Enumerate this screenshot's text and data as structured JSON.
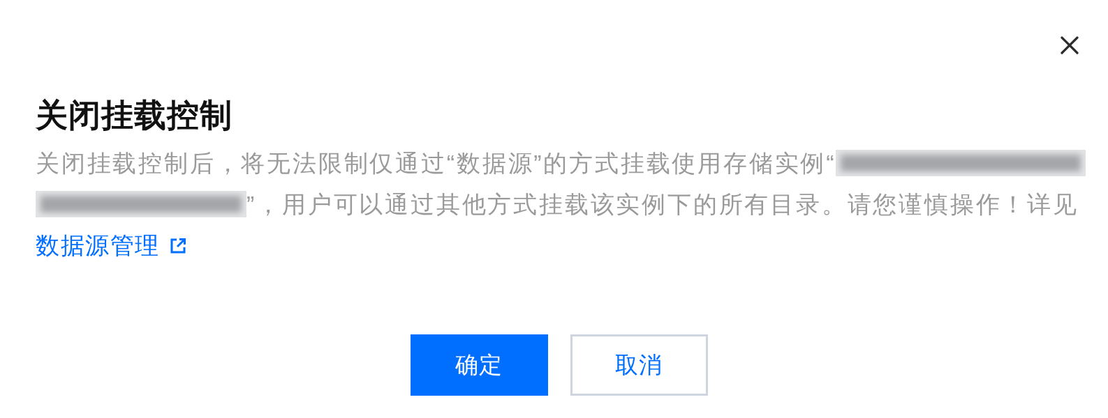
{
  "dialog": {
    "closable": true,
    "title": "关闭挂载控制",
    "description": [
      {
        "kind": "text",
        "text": "关闭挂载控制后，将无法限制仅通过“数据源”的方式挂载使用存储实例“"
      },
      {
        "kind": "redacted"
      },
      {
        "kind": "redacted"
      },
      {
        "kind": "text",
        "text": "”，用户可以通过其他方式挂载该实例下的所有目录。请您谨慎操作！详见"
      },
      {
        "kind": "link",
        "text": "数据源管理",
        "external": true
      }
    ],
    "buttons": [
      {
        "label": "确定",
        "kind": "primary"
      },
      {
        "label": "取消",
        "kind": "secondary"
      }
    ]
  }
}
